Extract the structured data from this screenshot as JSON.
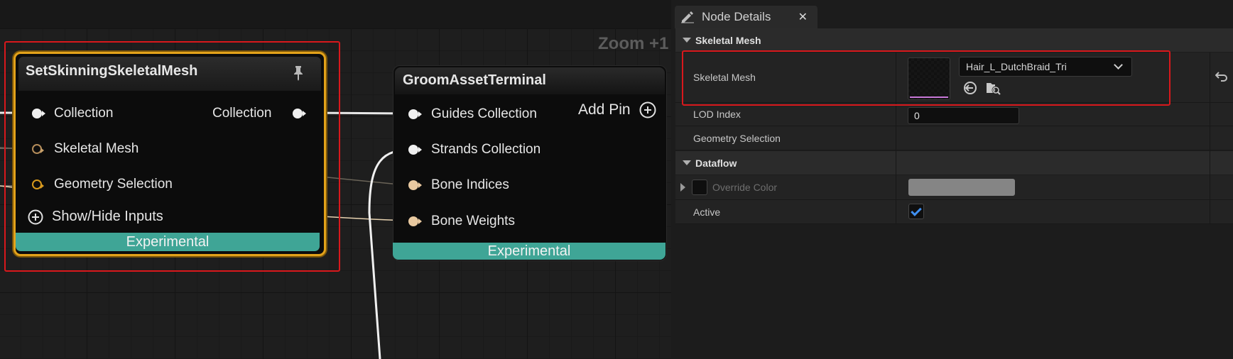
{
  "graph": {
    "zoom_label": "Zoom +1",
    "node1": {
      "title": "SetSkinningSkeletalMesh",
      "pins_in": [
        "Collection",
        "Skeletal Mesh",
        "Geometry Selection"
      ],
      "pin_out": "Collection",
      "show_hide": "Show/Hide Inputs",
      "footer": "Experimental"
    },
    "node2": {
      "title": "GroomAssetTerminal",
      "pins_in": [
        "Guides Collection",
        "Strands Collection",
        "Bone Indices",
        "Bone Weights"
      ],
      "add_pin": "Add Pin",
      "footer": "Experimental"
    }
  },
  "details": {
    "tab_label": "Node Details",
    "sections": [
      {
        "title": "Skeletal Mesh",
        "rows": [
          {
            "label": "Skeletal Mesh",
            "value": "Hair_L_DutchBraid_Tri"
          },
          {
            "label": "LOD Index",
            "value": "0"
          },
          {
            "label": "Geometry Selection",
            "value": ""
          }
        ]
      },
      {
        "title": "Dataflow",
        "rows": [
          {
            "label": "Override Color",
            "value": ""
          },
          {
            "label": "Active",
            "value": "checked"
          }
        ]
      }
    ]
  },
  "colors": {
    "experimental_bar": "#3fa596",
    "selected_node_border": "#e3a21a",
    "highlight_box": "#d9181c",
    "checkbox_accent": "#3f8ff0"
  }
}
